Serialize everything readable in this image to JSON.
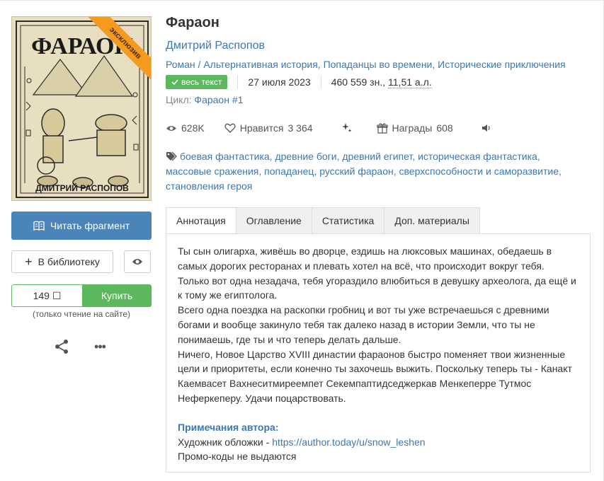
{
  "book": {
    "title": "Фараон",
    "author": "Дмитрий Распопов",
    "genres": [
      "Роман",
      "Альтернативная история",
      "Попаданцы во времени",
      "Исторические приключения"
    ],
    "genre_separator_first": " / ",
    "genre_separator": ", "
  },
  "cover": {
    "ribbon": "эксклюзив",
    "cover_title": "ФАРАОН",
    "cover_author": "ДМИТРИЙ РАСПОПОВ",
    "ribbon_color": "#f49a1c"
  },
  "meta": {
    "badge": "весь текст",
    "date": "27 июля 2023",
    "chars": "460 559 зн., ",
    "sheets": "11,51 а.л."
  },
  "cycle": {
    "label": "Цикл:",
    "value": "Фараон #1"
  },
  "stats": {
    "views": "628K",
    "likes_label": "Нравится",
    "likes": "3 364",
    "awards_label": "Награды",
    "awards": "608"
  },
  "tags": [
    "боевая фантастика",
    "древние боги",
    "древний египет",
    "историческая фантастика",
    "массовые сражения",
    "попаданец",
    "русский фараон",
    "сверхспособности и саморазвитие",
    "становления героя"
  ],
  "actions": {
    "read_fragment": "Читать фрагмент",
    "add_library": "В библиотеку",
    "price": "149 ☐",
    "buy": "Купить",
    "buy_note": "(только чтение на сайте)"
  },
  "tabs": [
    "Аннотация",
    "Оглавление",
    "Статистика",
    "Доп. материалы"
  ],
  "annotation": {
    "p1": "Ты сын олигарха, живёшь во дворце, ездишь на люксовых машинах, обедаешь в самых дорогих ресторанах и плевать хотел на всё, что происходит вокруг тебя. Только вот одна незадача, тебя угораздило влюбиться в девушку археолога, да ещё и к тому же египтолога.",
    "p2": "Всего одна поездка на раскопки гробниц и вот ты уже встречаешься с древними богами и вообще закинуло тебя так далеко назад в истории Земли, что ты не понимаешь, где ты и что теперь делать дальше.",
    "p3": "Ничего, Новое Царство XVIII династии фараонов быстро поменяет твои жизненные цели и приоритеты, если конечно ты захочешь выжить. Поскольку теперь ты - Канакт Каемвасет Вахнеситмиреемпет Секемпаптидседжеркав Менкеперре Тутмос Неферкеперу. Удачи поцарствовать.",
    "notes_title": "Примечания автора:",
    "artist_label": "Художник обложки - ",
    "artist_link": "https://author.today/u/snow_leshen",
    "promo": "Промо-коды не выдаются"
  },
  "colors": {
    "accent": "#3a78b5",
    "read_button": "#4a84b9",
    "buy_button": "#5cb85c"
  }
}
